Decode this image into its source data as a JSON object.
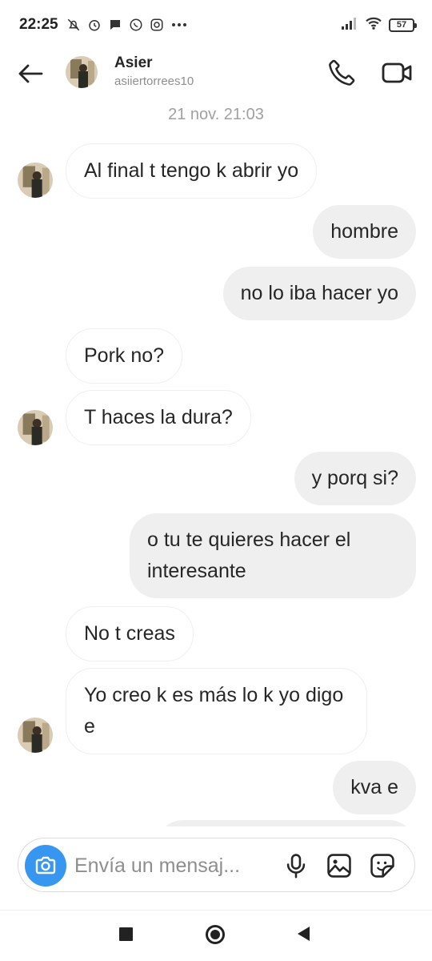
{
  "status_bar": {
    "time": "22:25",
    "icons_left": [
      "bell-off-icon",
      "alarm-icon",
      "chat-bubble-icon",
      "whatsapp-icon",
      "instagram-icon",
      "more-dots-icon"
    ],
    "icons_right": [
      "signal-icon",
      "wifi-icon",
      "battery-icon"
    ],
    "battery_level": "57"
  },
  "header": {
    "name": "Asier",
    "username": "asiiertorrees10"
  },
  "conversation": {
    "timestamp": "21 nov. 21:03",
    "messages": [
      {
        "from": "them",
        "text": "Al final t tengo k abrir yo"
      },
      {
        "from": "me",
        "text": "hombre"
      },
      {
        "from": "me",
        "text": "no lo iba hacer yo"
      },
      {
        "from": "them",
        "text": "Pork no?"
      },
      {
        "from": "them",
        "text": "T haces la dura?"
      },
      {
        "from": "me",
        "text": "y porq si?"
      },
      {
        "from": "me",
        "text": "o tu te quieres hacer el interesante"
      },
      {
        "from": "them",
        "text": "No t creas"
      },
      {
        "from": "them",
        "text": "Yo creo k es más lo k yo digo e"
      },
      {
        "from": "me",
        "text": "kva e"
      }
    ]
  },
  "composer": {
    "placeholder": "Envía un mensaj..."
  },
  "colors": {
    "accent": "#3797f0",
    "outgoing_bubble": "#efefef",
    "incoming_border": "#efefef",
    "secondary_text": "#8e8e8e"
  }
}
